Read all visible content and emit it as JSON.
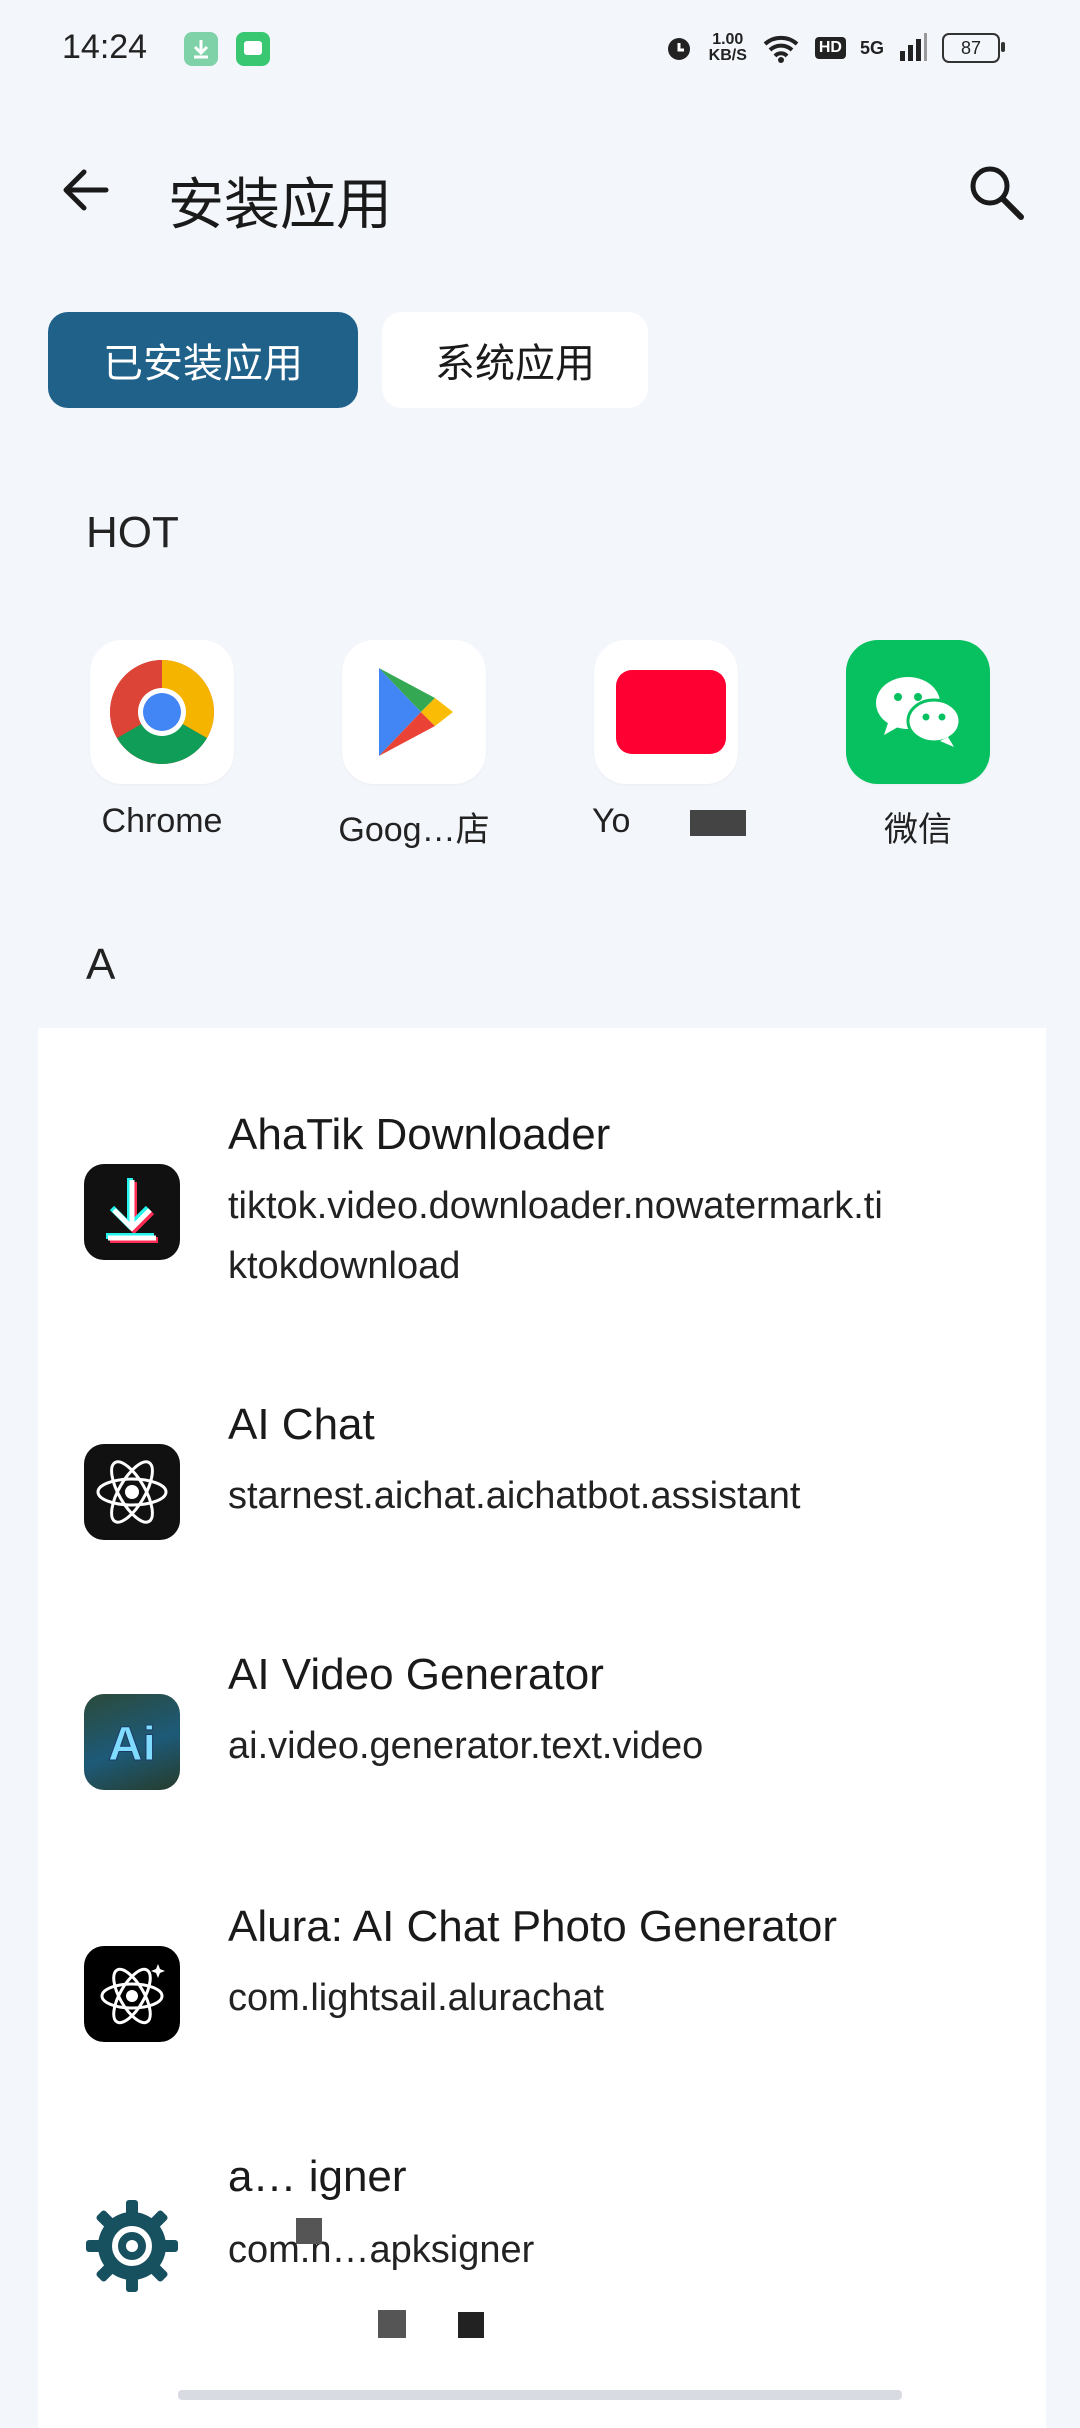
{
  "status_bar": {
    "time": "14:24",
    "net_speed": "1.00",
    "net_speed_unit": "KB/S",
    "hd": "HD",
    "signal": "5G",
    "battery": "87",
    "icons": [
      "download-notif-icon",
      "message-notif-icon",
      "alarm-icon",
      "wifi-icon",
      "signal-icon"
    ]
  },
  "header": {
    "title": "安装应用"
  },
  "tabs": [
    {
      "label": "已安装应用",
      "active": true
    },
    {
      "label": "系统应用",
      "active": false
    }
  ],
  "hot": {
    "label": "HOT",
    "apps": [
      {
        "name": "Chrome",
        "icon": "chrome-icon"
      },
      {
        "name": "Goog…店",
        "icon": "google-play-icon"
      },
      {
        "name": "Yo",
        "icon": "youtube-icon"
      },
      {
        "name": "微信",
        "icon": "wechat-icon"
      }
    ]
  },
  "section_a": {
    "label": "A",
    "apps": [
      {
        "name": "AhaTik Downloader",
        "package": "tiktok.video.downloader.nowatermark.ti ktokdownload",
        "icon": "download-app-icon"
      },
      {
        "name": "AI Chat",
        "package": "starnest.aichat.aichatbot.assistant",
        "icon": "atom-icon"
      },
      {
        "name": "AI Video Generator",
        "package": "ai.video.generator.text.video",
        "icon": "ai-video-icon"
      },
      {
        "name": "Alura: AI Chat Photo Generator",
        "package": "com.lightsail.alurachat",
        "icon": "alura-atom-icon"
      },
      {
        "name": "a… igner",
        "package": "com.h…apksigner",
        "icon": "gear-icon"
      }
    ]
  },
  "colors": {
    "accent": "#1f6189",
    "background": "#f3f6fb",
    "card": "#ffffff"
  }
}
